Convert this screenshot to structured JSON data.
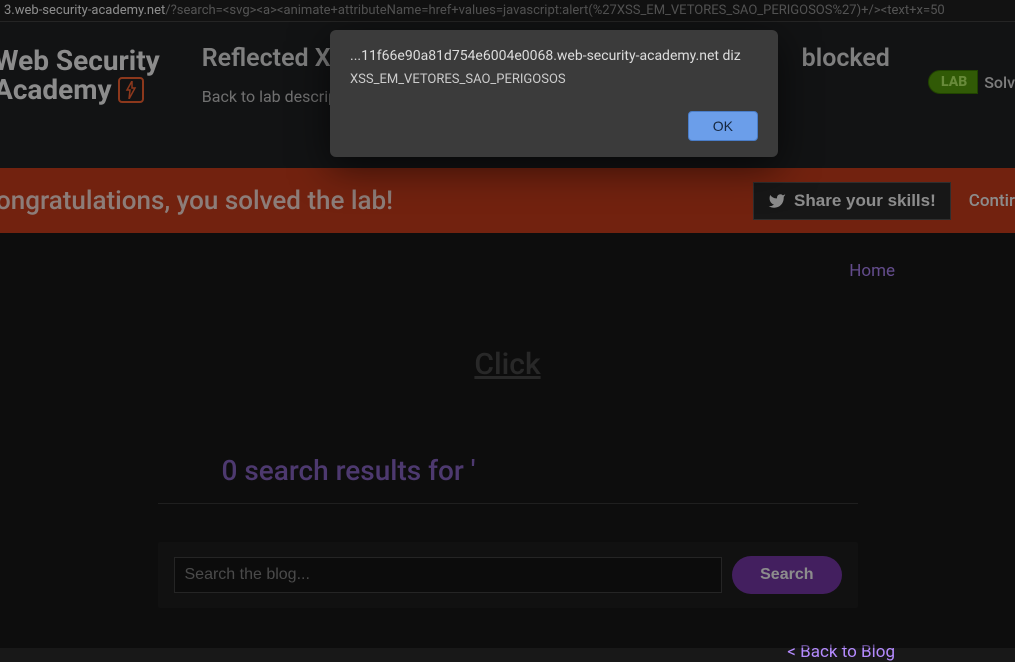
{
  "address_bar": {
    "domain": "3.web-security-academy.net",
    "path": "/?search=<svg><a><animate+attributeName=href+values=javascript:alert(%27XSS_EM_VETORES_SAO_PERIGOSOS%27)+/><text+x=50"
  },
  "header": {
    "logo_line1": "Web Security",
    "logo_line2": "Academy",
    "lab_title_left": "Reflected XS",
    "lab_title_right": "blocked",
    "back_link": "Back to lab descrip",
    "lab_badge": "LAB",
    "solved_text": "Solv"
  },
  "alert": {
    "origin": "...11f66e90a81d754e6004e0068.web-security-academy.net diz",
    "message": "XSS_EM_VETORES_SAO_PERIGOSOS",
    "ok_label": "OK"
  },
  "banner": {
    "congrats": "ongratulations, you solved the lab!",
    "share_label": "Share your skills!",
    "continue_label": "Contir"
  },
  "nav": {
    "home": "Home"
  },
  "content": {
    "click_label": "Click",
    "results_text": "0 search results for '",
    "search_placeholder": "Search the blog...",
    "search_button": "Search",
    "back_to_blog": "< Back to Blog"
  }
}
